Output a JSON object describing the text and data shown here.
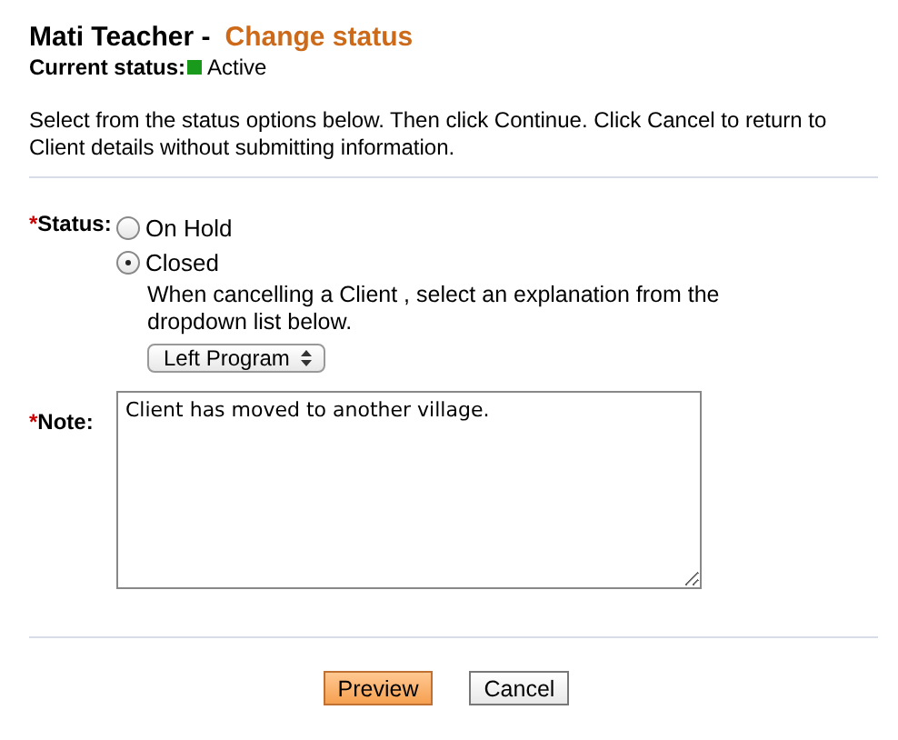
{
  "header": {
    "name": "Mati Teacher -",
    "title": "Change status"
  },
  "current_status": {
    "label": "Current status:",
    "value": "Active",
    "color": "#1a9a1a"
  },
  "instructions": "Select from the status options below. Then click Continue. Click Cancel to return to Client details without submitting information.",
  "status_field": {
    "required_mark": "*",
    "label": "Status:",
    "options": [
      {
        "label": "On Hold",
        "selected": false
      },
      {
        "label": "Closed",
        "selected": true
      }
    ],
    "explanation": "When cancelling a Client , select an explanation from the dropdown list below.",
    "dropdown": {
      "value": "Left Program"
    }
  },
  "note_field": {
    "required_mark": "*",
    "label": "Note:",
    "value": "Client has moved to another village."
  },
  "buttons": [
    {
      "label": "Preview",
      "kind": "primary"
    },
    {
      "label": "Cancel",
      "kind": "secondary"
    }
  ]
}
